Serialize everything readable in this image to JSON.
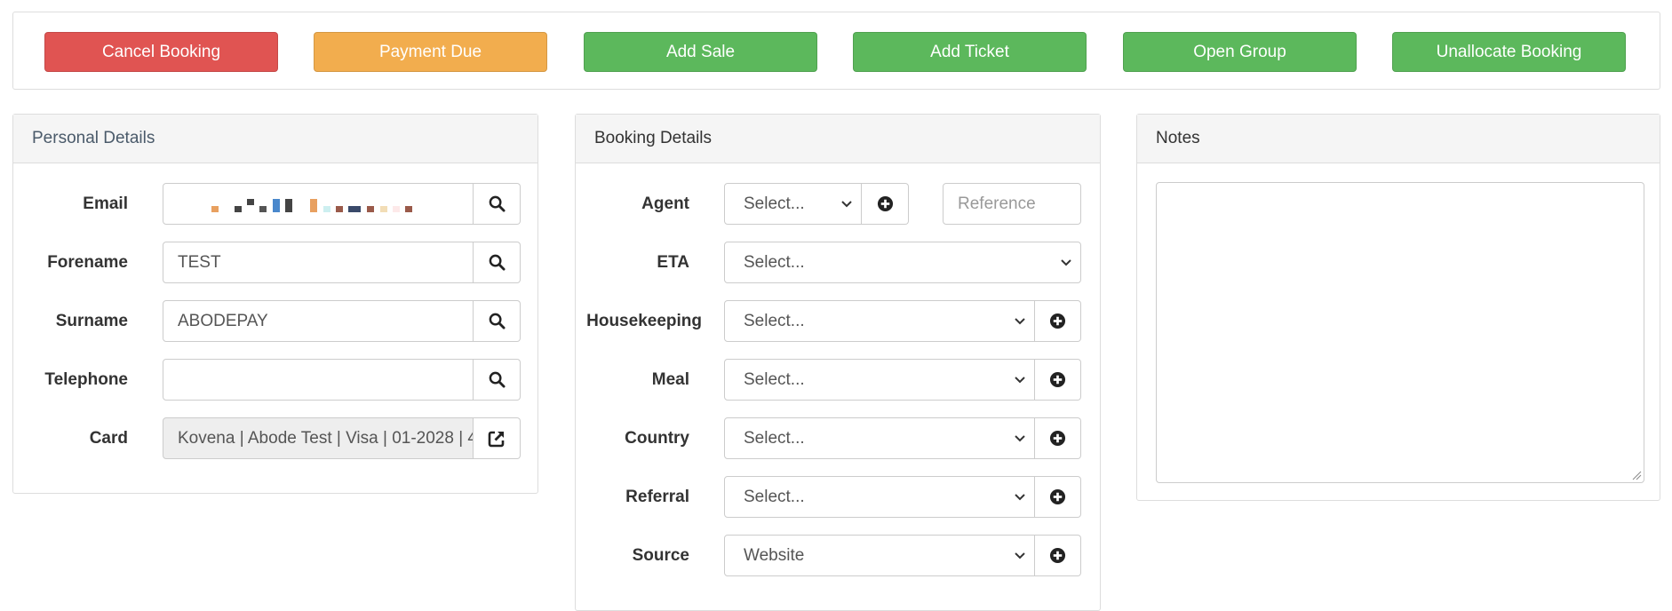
{
  "toolbar": {
    "buttons": [
      {
        "label": "Cancel Booking",
        "color": "#e05452"
      },
      {
        "label": "Payment Due",
        "color": "#f2ad4e"
      },
      {
        "label": "Add Sale",
        "color": "#5cb85c"
      },
      {
        "label": "Add Ticket",
        "color": "#5cb85c"
      },
      {
        "label": "Open Group",
        "color": "#5cb85c"
      },
      {
        "label": "Unallocate Booking",
        "color": "#5cb85c"
      }
    ]
  },
  "personal": {
    "title": "Personal Details",
    "email_label": "Email",
    "email_value": "",
    "forename_label": "Forename",
    "forename_value": "TEST",
    "surname_label": "Surname",
    "surname_value": "ABODEPAY",
    "telephone_label": "Telephone",
    "telephone_value": "",
    "card_label": "Card",
    "card_value": "Kovena | Abode Test | Visa | 01-2028 | 4"
  },
  "booking": {
    "title": "Booking Details",
    "agent_label": "Agent",
    "agent_value": "Select...",
    "reference_placeholder": "Reference",
    "eta_label": "ETA",
    "eta_value": "Select...",
    "housekeeping_label": "Housekeeping",
    "housekeeping_value": "Select...",
    "meal_label": "Meal",
    "meal_value": "Select...",
    "country_label": "Country",
    "country_value": "Select...",
    "referral_label": "Referral",
    "referral_value": "Select...",
    "source_label": "Source",
    "source_value": "Website"
  },
  "notes": {
    "title": "Notes",
    "value": ""
  },
  "icons": {
    "search": "search-icon",
    "external": "external-link-icon",
    "plus": "plus-circle-icon",
    "chevron": "chevron-down-icon"
  }
}
